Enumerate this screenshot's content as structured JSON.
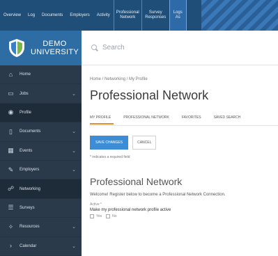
{
  "topnav": {
    "items": [
      {
        "label": "Overview"
      },
      {
        "label": "Log"
      },
      {
        "label": "Documents"
      },
      {
        "label": "Employers"
      },
      {
        "label": "Activity"
      },
      {
        "label": "Professional\nNetwork"
      },
      {
        "label": "Survey\nResponses"
      },
      {
        "label": "Logs\nAs"
      }
    ]
  },
  "logo": {
    "line1": "DEMO",
    "line2": "UNIVERSITY"
  },
  "search": {
    "placeholder": "Search",
    "icon": "search-icon"
  },
  "sidebar": {
    "items": [
      {
        "label": "Home",
        "icon": "home-icon",
        "glyph": "⌂"
      },
      {
        "label": "Jobs",
        "icon": "briefcase-icon",
        "glyph": "▭",
        "chevron": "⌄"
      },
      {
        "label": "Profile",
        "icon": "profile-icon",
        "glyph": "◉"
      },
      {
        "label": "Documents",
        "icon": "document-icon",
        "glyph": "▯",
        "chevron": "⌄"
      },
      {
        "label": "Events",
        "icon": "calendar-icon",
        "glyph": "▦",
        "chevron": "⌄"
      },
      {
        "label": "Employers",
        "icon": "handshake-icon",
        "glyph": "✎",
        "chevron": "⌄"
      },
      {
        "label": "Networking",
        "icon": "network-icon",
        "glyph": "☍"
      },
      {
        "label": "Surveys",
        "icon": "survey-icon",
        "glyph": "☰"
      },
      {
        "label": "Resources",
        "icon": "resources-icon",
        "glyph": "✧",
        "chevron": "⌄"
      },
      {
        "label": "Calendar",
        "icon": "calendar-icon",
        "glyph": "›",
        "chevron": "⌄"
      }
    ]
  },
  "breadcrumb": "Home / Networking / My Profile",
  "page_title": "Professional Network",
  "tabs": [
    {
      "label": "MY PROFILE"
    },
    {
      "label": "PROFESSIONAL NETWORK"
    },
    {
      "label": "FAVORITES"
    },
    {
      "label": "SAVED SEARCH"
    }
  ],
  "buttons": {
    "save": "SAVE CHANGES",
    "cancel": "CANCEL"
  },
  "required_note": "* indicates a required field",
  "section_title": "Professional Network",
  "intro": "Welcome! Register below to become a Professional Network Connection.",
  "field": {
    "label": "Active *",
    "description": "Make my professional network profile active",
    "options": [
      "Yes",
      "No"
    ]
  },
  "colors": {
    "topnav": "#1f4e79",
    "logo_bg": "#2e6da4",
    "sidebar": "#2b3a4a",
    "accent_tab": "#e08e2b",
    "primary_button": "#3c8dd6"
  }
}
